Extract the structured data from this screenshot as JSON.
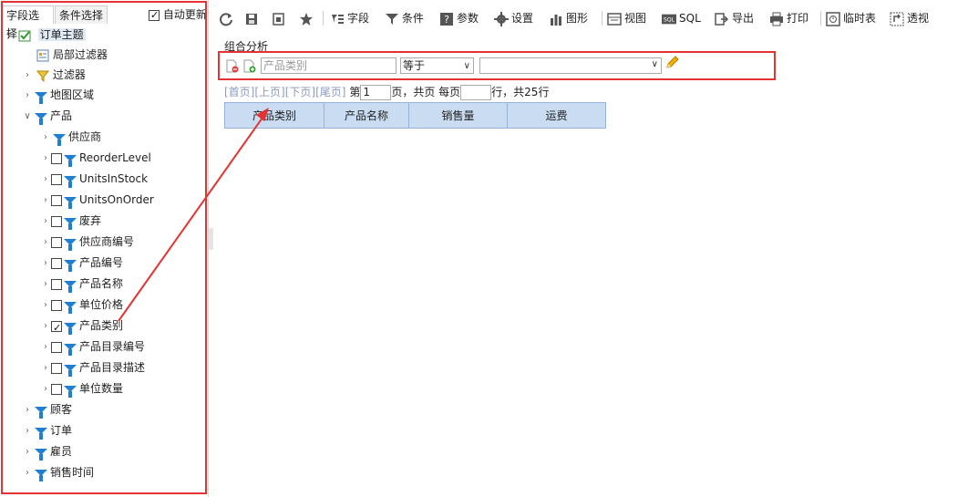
{
  "left_panel": {
    "tabs": [
      "字段选择",
      "条件选择"
    ],
    "auto_update_label": "自动更新",
    "root_label": "订单主题",
    "nodes": [
      {
        "label": "局部过滤器"
      },
      {
        "label": "过滤器"
      },
      {
        "label": "地图区域"
      },
      {
        "label": "产品"
      },
      {
        "label": "供应商"
      },
      {
        "label": "ReorderLevel"
      },
      {
        "label": "UnitsInStock"
      },
      {
        "label": "UnitsOnOrder"
      },
      {
        "label": "废弃"
      },
      {
        "label": "供应商编号"
      },
      {
        "label": "产品编号"
      },
      {
        "label": "产品名称"
      },
      {
        "label": "单位价格"
      },
      {
        "label": "产品类别"
      },
      {
        "label": "产品目录编号"
      },
      {
        "label": "产品目录描述"
      },
      {
        "label": "单位数量"
      },
      {
        "label": "顾客"
      },
      {
        "label": "订单"
      },
      {
        "label": "雇员"
      },
      {
        "label": "销售时间"
      }
    ]
  },
  "toolbar": {
    "fields": "字段",
    "conditions": "条件",
    "params": "参数",
    "settings": "设置",
    "chart": "图形",
    "view": "视图",
    "sql": "SQL",
    "export": "导出",
    "print": "打印",
    "temp_table": "临时表",
    "pivot": "透视"
  },
  "main": {
    "section_title": "组合分析",
    "condition": {
      "field_placeholder": "产品类别",
      "operator": "等于",
      "value": ""
    },
    "pager": {
      "first": "[首页]",
      "prev": "[上页]",
      "next": "[下页]",
      "last": "[尾页]",
      "page_prefix": "第",
      "page_value": "1",
      "page_suffix": "页，共页 每页",
      "rows_value": "",
      "rows_suffix": "行，共25行"
    },
    "columns": [
      "产品类别",
      "产品名称",
      "销售量",
      "运费"
    ]
  },
  "colors": {
    "accent_red": "#e53333",
    "funnel_blue": "#1f7fd3",
    "grid_header": "#c9dcf2"
  }
}
